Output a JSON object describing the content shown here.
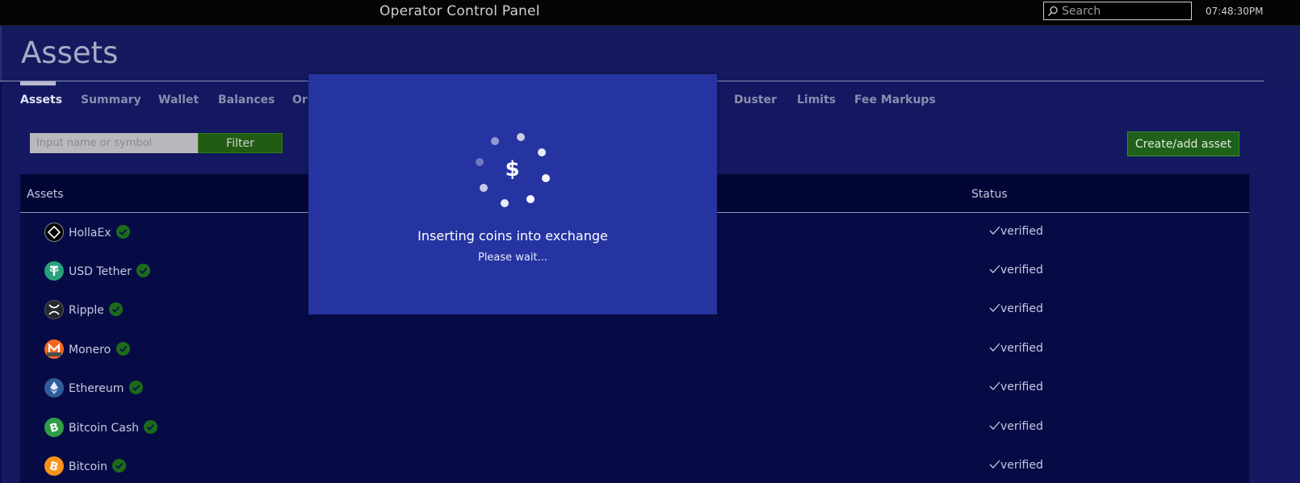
{
  "topbar": {
    "title": "Operator Control Panel",
    "search_placeholder": "Search",
    "clock": "07:48:30PM"
  },
  "header": {
    "title": "Assets"
  },
  "tabs": [
    {
      "label": "Assets",
      "active": true
    },
    {
      "label": "Summary",
      "active": false
    },
    {
      "label": "Wallet",
      "active": false
    },
    {
      "label": "Balances",
      "active": false
    },
    {
      "label": "Or",
      "active": false
    },
    {
      "label": "Duster",
      "active": false
    },
    {
      "label": "Limits",
      "active": false
    },
    {
      "label": "Fee Markups",
      "active": false
    }
  ],
  "filter": {
    "placeholder": "Input name or symbol",
    "button_label": "Filter"
  },
  "create_button_label": "Create/add asset",
  "table": {
    "columns": [
      "Assets",
      "Status"
    ],
    "rows": [
      {
        "name": "HollaEx",
        "status": "verified",
        "icon": "hollaex-icon",
        "color": "#000000"
      },
      {
        "name": "USD Tether",
        "status": "verified",
        "icon": "tether-icon",
        "color": "#26a17b"
      },
      {
        "name": "Ripple",
        "status": "verified",
        "icon": "ripple-icon",
        "color": "#23292f"
      },
      {
        "name": "Monero",
        "status": "verified",
        "icon": "monero-icon",
        "color": "#f26822"
      },
      {
        "name": "Ethereum",
        "status": "verified",
        "icon": "ethereum-icon",
        "color": "#2f5d9c"
      },
      {
        "name": "Bitcoin Cash",
        "status": "verified",
        "icon": "bitcoin-cash-icon",
        "color": "#2f9e45"
      },
      {
        "name": "Bitcoin",
        "status": "verified",
        "icon": "bitcoin-icon",
        "color": "#f7931a"
      }
    ]
  },
  "modal": {
    "message": "Inserting coins into exchange",
    "sub": "Please wait...",
    "icon_symbol": "$"
  }
}
